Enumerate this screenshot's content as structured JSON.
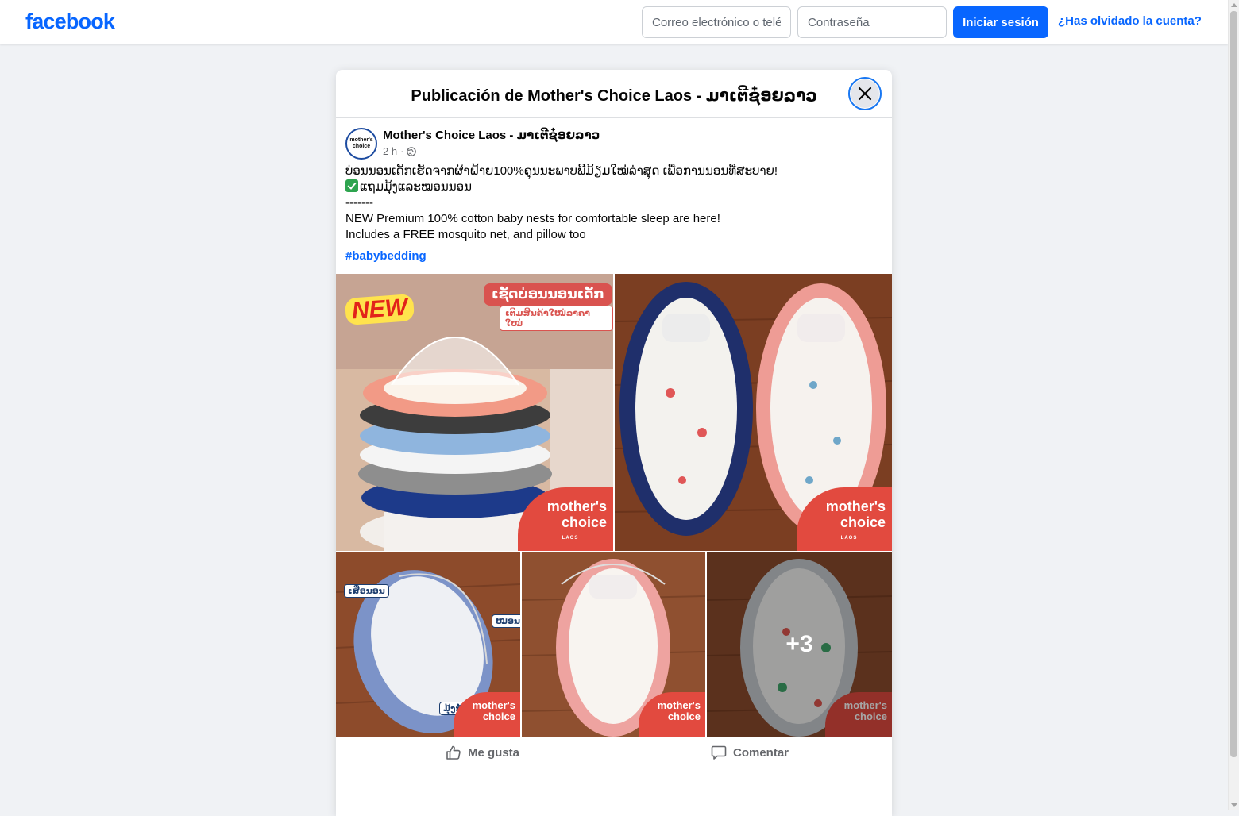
{
  "topbar": {
    "logo": "facebook",
    "email_placeholder": "Correo electrónico o teléfono",
    "password_placeholder": "Contraseña",
    "login_label": "Iniciar sesión",
    "forgot_label": "¿Has olvidado la cuenta?"
  },
  "modal": {
    "title": "Publicación de Mother's Choice Laos - ມາເຕີຊ໋ອຍລາວ"
  },
  "post": {
    "author": "Mother's Choice Laos - ມາເຕີຊ໋ອຍລາວ",
    "avatar_text": "mother's choice",
    "time": "2 h",
    "meta_separator": "·",
    "lines": [
      "ບ່ອນນອນເດັກເຮັດຈາກຜ້າຝ້າຍ100%ຄຸນນະພາບພີມ້ຽມໃໝ່ລ່າສຸດ ເພື່ອການນອນທີ່ສະບາຍ!",
      "ແຖມມຸ້ງແລະໝອນນອນ",
      "-------",
      "NEW Premium 100% cotton baby nests for comfortable sleep are here!",
      "Includes a FREE mosquito net, and pillow too"
    ],
    "hashtag": "#babybedding"
  },
  "photos": {
    "new_badge": "NEW",
    "promo_title": "ເຊັດບ່ອນນອນເດັກ",
    "promo_subtitle": "ເຕີມສິນຄ້າໃໝ່ລາຄາໃໝ່",
    "brand_line1": "mother's",
    "brand_line2": "choice",
    "brand_sub": "LAOS",
    "tag_mat": "ເສື່ອນອນ",
    "tag_pillow": "ໝອນ",
    "tag_net": "ມຸ້ງກັນຍຸງ",
    "more_count": "+3"
  },
  "actions": {
    "like_label": "Me gusta",
    "comment_label": "Comentar"
  },
  "colors": {
    "brand_blue": "#0866ff",
    "page_bg": "#f0f2f5",
    "badge_red": "#e24a3f"
  },
  "icons": {
    "close": "close-icon",
    "globe": "globe-icon",
    "like": "thumbs-up-icon",
    "comment": "comment-bubble-icon",
    "check": "check-mark-icon"
  }
}
